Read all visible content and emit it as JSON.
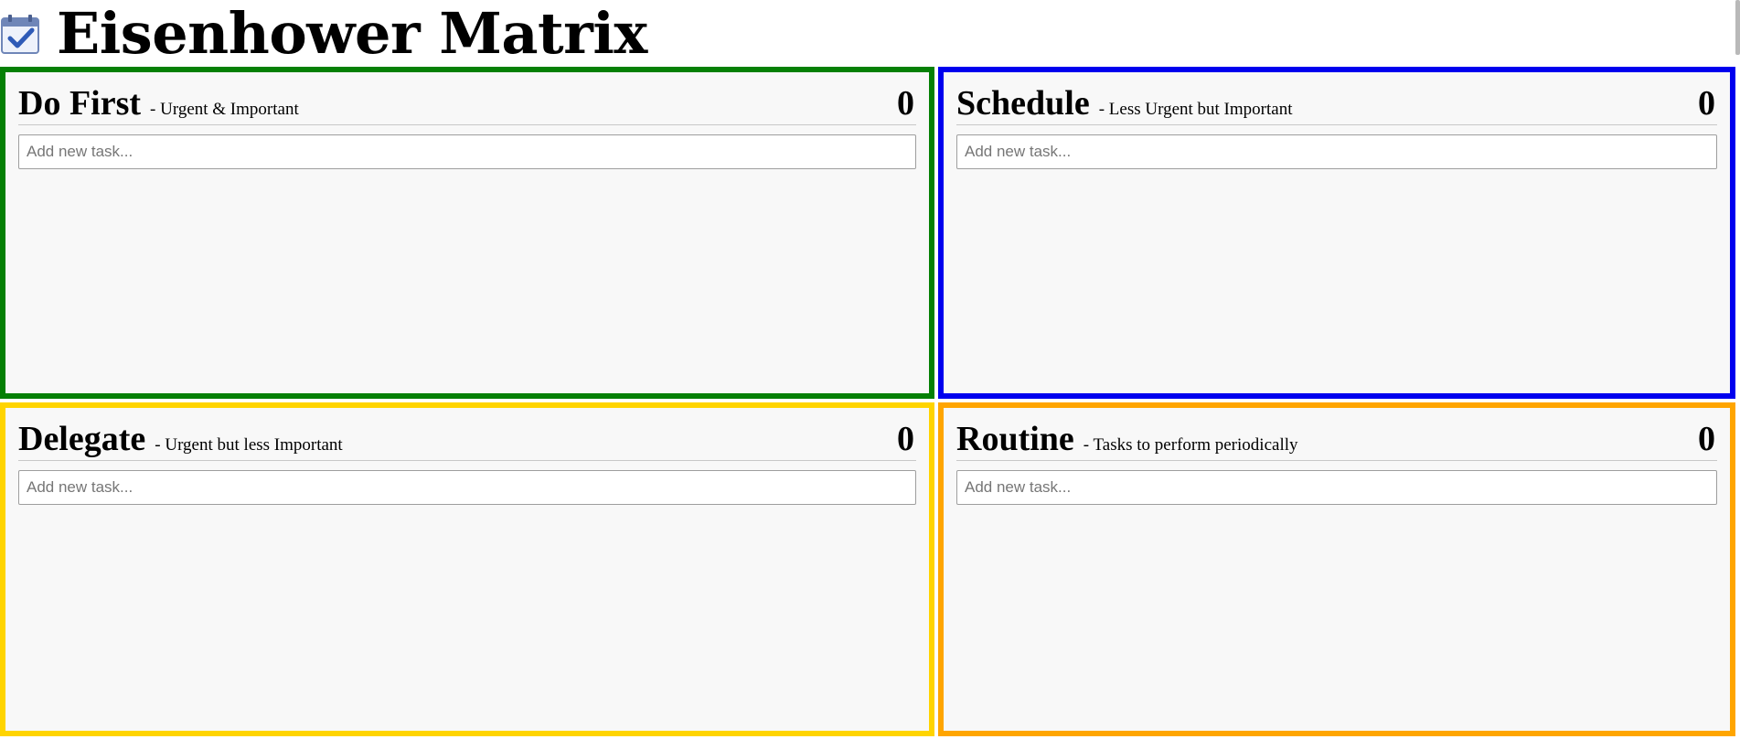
{
  "app": {
    "title": "Eisenhower Matrix",
    "icon": "calendar-check-icon"
  },
  "colors": {
    "do_first": "#058005",
    "schedule": "#0000ee",
    "delegate": "#ffd400",
    "routine": "#ffa500",
    "quadrant_background": "#f8f8f8"
  },
  "quadrants": [
    {
      "name": "Do First",
      "subtitle": "- Urgent & Important",
      "count": "0",
      "input_placeholder": "Add new task...",
      "input_value": "",
      "tasks": []
    },
    {
      "name": "Schedule",
      "subtitle": "- Less Urgent but Important",
      "count": "0",
      "input_placeholder": "Add new task...",
      "input_value": "",
      "tasks": []
    },
    {
      "name": "Delegate",
      "subtitle": "- Urgent but less Important",
      "count": "0",
      "input_placeholder": "Add new task...",
      "input_value": "",
      "tasks": []
    },
    {
      "name": "Routine",
      "subtitle": "- Tasks to perform periodically",
      "count": "0",
      "input_placeholder": "Add new task...",
      "input_value": "",
      "tasks": []
    }
  ]
}
